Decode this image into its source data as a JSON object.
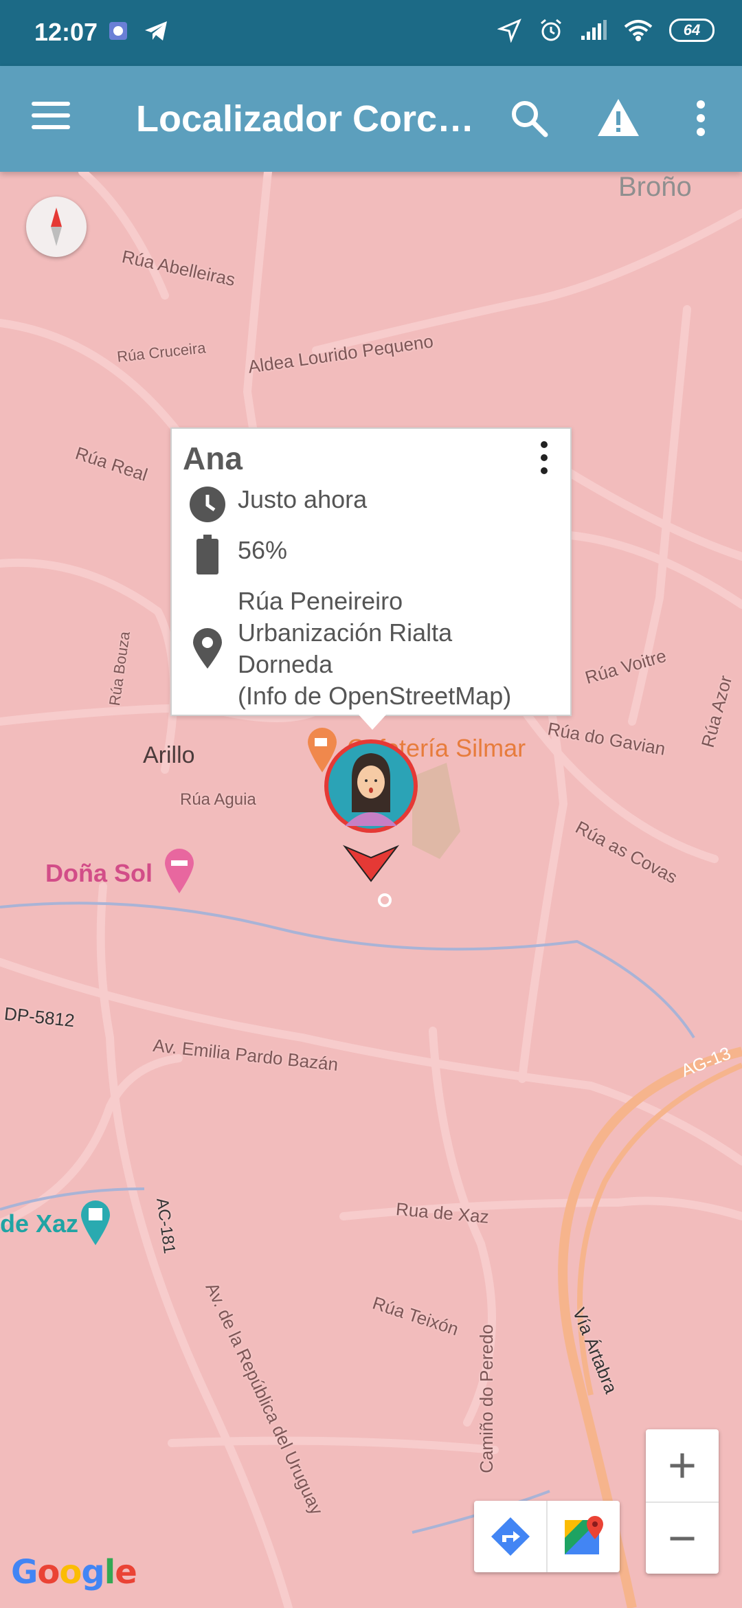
{
  "status_bar": {
    "time": "12:07",
    "battery": "64"
  },
  "app_bar": {
    "title": "Localizador Corcaaaa",
    "icons": [
      "menu-icon",
      "search-icon",
      "warning-icon",
      "more-vert-icon"
    ]
  },
  "popup": {
    "name": "Ana",
    "last_seen": "Justo ahora",
    "battery": "56%",
    "address": [
      "Rúa Peneireiro",
      "Urbanización Rialta",
      "Dorneda",
      "(Info de OpenStreetMap)"
    ]
  },
  "map": {
    "places": {
      "brono": "Broño",
      "arillo": "Arillo",
      "dona_sol": "Doña Sol",
      "cafeteria": "Cafetería Silmar",
      "de_xaz": "de Xaz"
    },
    "streets": {
      "abelleiras": "Rúa Abelleiras",
      "aldea_lourido": "Aldea Lourido Pequeno",
      "cruceira": "Rúa Cruceira",
      "real": "Rúa Real",
      "bouza": "Rúa Bouza",
      "aguia": "Rúa Aguia",
      "voitre": "Rúa Voitre",
      "azor": "Rúa Azor",
      "gavian": "Rúa do Gavian",
      "covas": "Rúa as Covas",
      "dp5812": "DP-5812",
      "emilia": "Av. Emilia Pardo Bazán",
      "ag13": "AG-13",
      "xaz": "Rua de Xaz",
      "ac181": "AC-181",
      "teixon": "Rúa Teixón",
      "peredo": "Camiño do Peredo",
      "artabra": "Vía Ártabra",
      "uruguay": "Av. de la República del Uruguay"
    },
    "google_logo": "Google"
  },
  "controls": {
    "zoom_in": "+",
    "zoom_out": "−"
  },
  "colors": {
    "status_bar": "#1c6a86",
    "app_bar": "#5c9fbd",
    "map_bg": "#f2bcbc",
    "marker": "#e53935"
  }
}
